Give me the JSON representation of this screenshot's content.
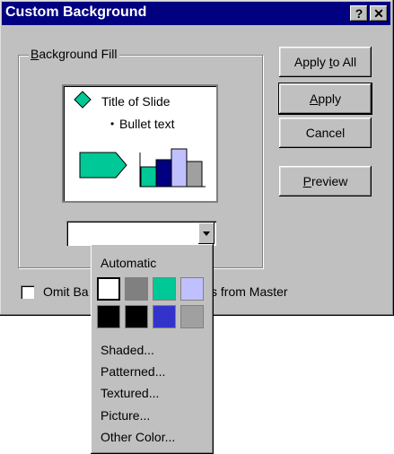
{
  "window": {
    "title": "Custom Background",
    "help_button": "?",
    "close_button": "✕"
  },
  "group": {
    "label": "Background Fill"
  },
  "preview": {
    "title_text": "Title of Slide",
    "bullet_text": "Bullet text",
    "bullet_glyph": "•",
    "colors": {
      "accent": "#00c896",
      "navy": "#000080",
      "lavender": "#c0c0ff",
      "gray": "#a0a0a0"
    }
  },
  "buttons": {
    "apply_all": "Apply to All",
    "apply": "Apply",
    "cancel": "Cancel",
    "preview": "Preview"
  },
  "omit_checkbox": {
    "label_left": "Omit Ba",
    "label_right": "s from Master",
    "checked": false
  },
  "combo": {
    "value": ""
  },
  "color_menu": {
    "automatic_label": "Automatic",
    "swatches": [
      "#ffffff",
      "#808080",
      "#00c896",
      "#c0c0ff",
      "#000000",
      "#000000",
      "#3333cc",
      "#a0a0a0"
    ],
    "selected_index": 0,
    "items": [
      "Shaded...",
      "Patterned...",
      "Textured...",
      "Picture...",
      "Other Color..."
    ]
  }
}
